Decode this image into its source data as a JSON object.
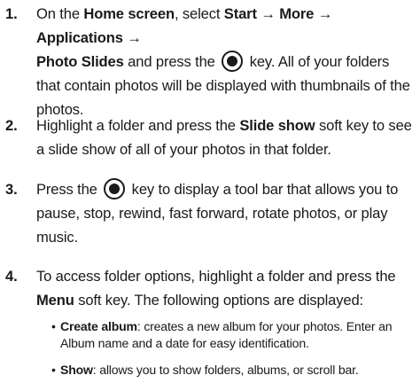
{
  "steps": [
    {
      "number": "1.",
      "segments": [
        {
          "text": "On the ",
          "bold": false
        },
        {
          "text": "Home screen",
          "bold": true
        },
        {
          "text": ", select ",
          "bold": false
        },
        {
          "text": "Start → More → Applications →",
          "bold": true
        },
        {
          "text": "Photo Slides",
          "bold": true
        },
        {
          "text": " and press the ",
          "bold": false
        },
        {
          "icon": "ok-key-icon"
        },
        {
          "text": " key. All of your folders that contain photos will be displayed with thumbnails of the photos.",
          "bold": false
        }
      ]
    },
    {
      "number": "2.",
      "segments": [
        {
          "text": "Highlight a folder and press the ",
          "bold": false
        },
        {
          "text": "Slide show",
          "bold": true
        },
        {
          "text": " soft key to see a slide show of all of your photos in that folder.",
          "bold": false
        }
      ]
    },
    {
      "number": "3.",
      "segments": [
        {
          "text": "Press the ",
          "bold": false
        },
        {
          "icon": "ok-key-icon"
        },
        {
          "text": " key to display a tool bar that allows you to pause, stop, rewind, fast forward, rotate photos, or play music.",
          "bold": false
        }
      ]
    },
    {
      "number": "4.",
      "segments": [
        {
          "text": "To access folder options, highlight a folder and press the ",
          "bold": false
        },
        {
          "text": "Menu",
          "bold": true
        },
        {
          "text": " soft key. The following options are displayed:",
          "bold": false
        }
      ]
    }
  ],
  "options": [
    {
      "bullet": "•",
      "term": "Create album",
      "description": ": creates a new album for your photos. Enter an Album name and a date for easy identification."
    },
    {
      "bullet": "•",
      "term": "Show",
      "description": ": allows you to show folders, albums, or scroll bar."
    }
  ]
}
